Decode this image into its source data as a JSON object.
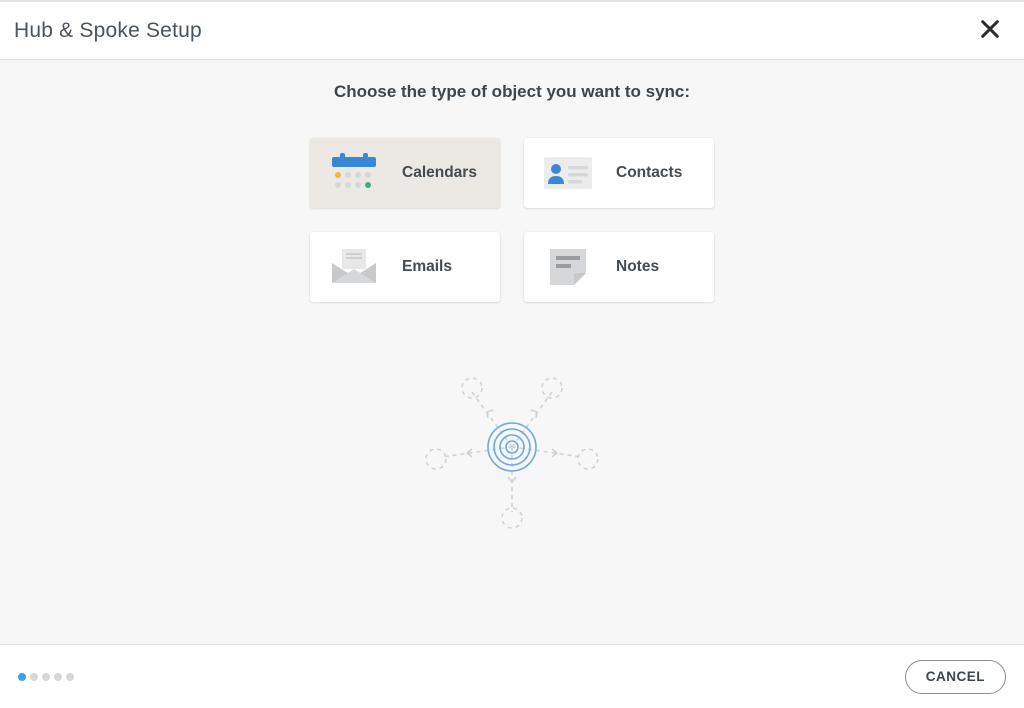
{
  "header": {
    "title": "Hub & Spoke Setup"
  },
  "body": {
    "prompt": "Choose the type of object you want to sync:",
    "options": [
      {
        "label": "Calendars",
        "icon": "calendar-icon",
        "selected": true
      },
      {
        "label": "Contacts",
        "icon": "contact-icon",
        "selected": false
      },
      {
        "label": "Emails",
        "icon": "email-icon",
        "selected": false
      },
      {
        "label": "Notes",
        "icon": "note-icon",
        "selected": false
      }
    ]
  },
  "footer": {
    "steps_total": 5,
    "steps_current": 1,
    "cancel_label": "CANCEL"
  },
  "colors": {
    "accent": "#3a87d6",
    "muted_icon": "#d6d7d8",
    "text": "#3d464d"
  }
}
